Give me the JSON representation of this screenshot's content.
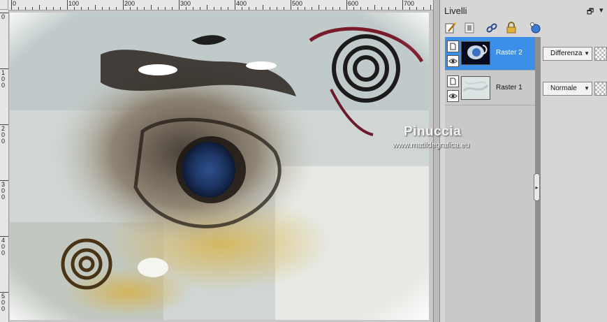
{
  "editor": {
    "ruler_top_labels": [
      "0",
      "100",
      "200",
      "300",
      "400",
      "500",
      "600",
      "700"
    ],
    "ruler_left_labels": [
      "0",
      "100",
      "200",
      "300",
      "400",
      "500"
    ]
  },
  "panel": {
    "title": "Livelli",
    "window_control": "🗗",
    "menu_arrow": "▾",
    "toolbar_icons": [
      "new-raster-icon",
      "new-mask-icon",
      "link-icon",
      "lock-icon",
      "layer-style-icon"
    ]
  },
  "layers": [
    {
      "name": "Raster 2",
      "blend_mode": "Differenza",
      "selected": true,
      "visible": true
    },
    {
      "name": "Raster 1",
      "blend_mode": "Normale",
      "selected": false,
      "visible": true
    }
  ],
  "watermark": {
    "line1": "Pinuccia",
    "line2": "www.matildegrafica.eu"
  },
  "colors": {
    "selection": "#3b8fe8",
    "panel_bg": "#d6d6d6"
  }
}
